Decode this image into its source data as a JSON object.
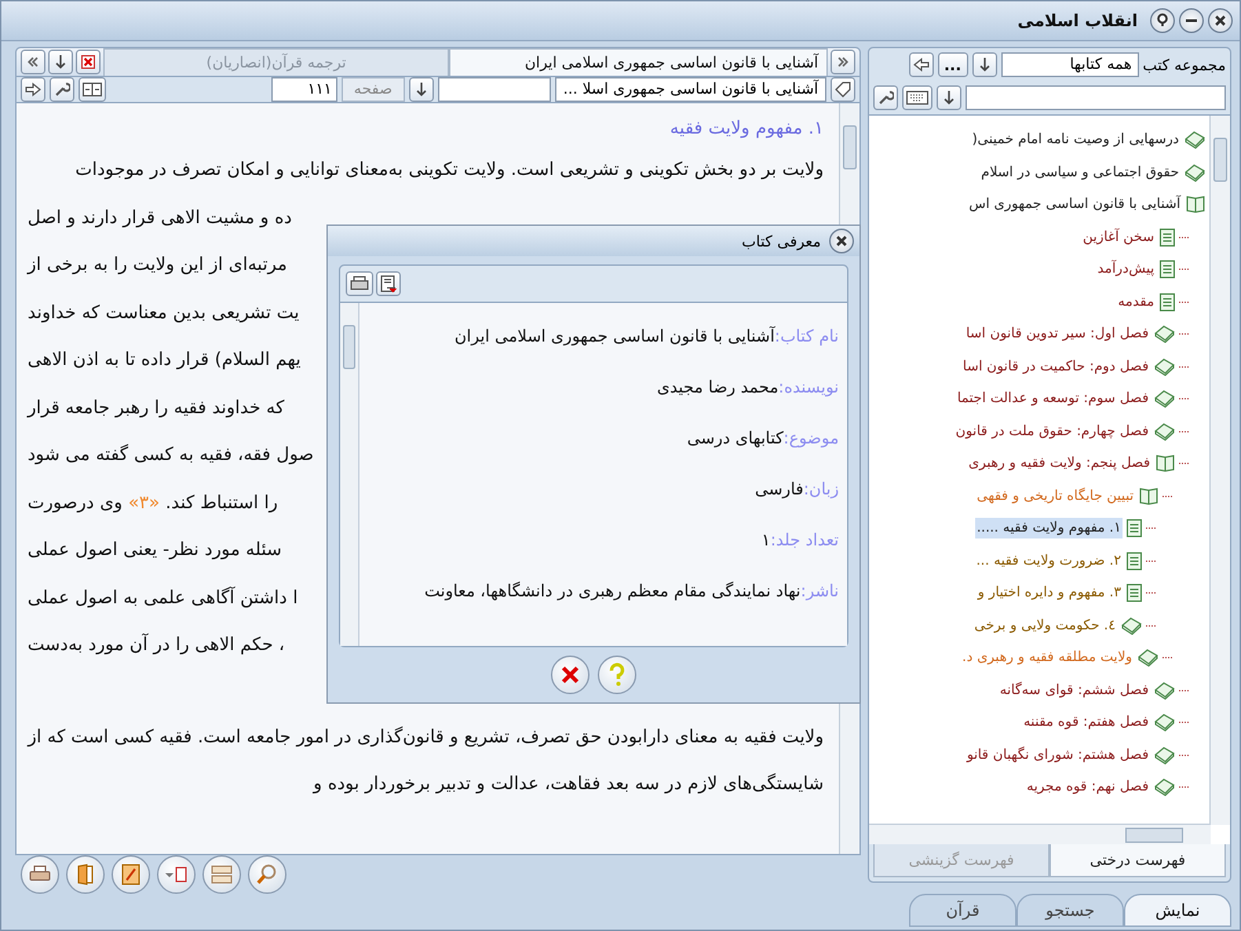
{
  "window": {
    "title": "انقلاب اسلامی"
  },
  "reader": {
    "tabs": [
      {
        "label": "آشنایی با قانون اساسی جمهوری اسلامی ایران",
        "selected": true
      },
      {
        "label": "ترجمه قرآن(انصاریان)",
        "selected": false
      }
    ],
    "book_select": "آشنایی با قانون اساسی جمهوری اسلا ...",
    "page_label": "صفحه",
    "page_value": "۱۱۱",
    "heading": "۱. مفهوم ولایت فقیه",
    "paragraphs": [
      {
        "lines": [
          {
            "kind": "full",
            "segments": [
              {
                "text": "ولایت بر دو بخش تکوینی و تشریعی است. ولایت تکوینی به‌معنای توانایی و امکان تصرف در موجودات"
              }
            ]
          },
          {
            "kind": "partial",
            "segments": [
              {
                "text": "ده و مشیت الاهی قرار دارند و اصل"
              }
            ]
          },
          {
            "kind": "partial",
            "segments": [
              {
                "text": "مرتبه‌ای از این ولایت را به برخی از"
              }
            ]
          },
          {
            "kind": "partial",
            "segments": [
              {
                "text": "یت تشریعی بدین معناست که خداوند"
              }
            ]
          },
          {
            "kind": "partial",
            "segments": [
              {
                "text": "یهم السلام) قرار داده تا به اذن الاهی"
              }
            ]
          },
          {
            "kind": "partial",
            "segments": [
              {
                "text": "که خداوند فقیه را رهبر جامعه قرار"
              }
            ]
          },
          {
            "kind": "partial",
            "segments": [
              {
                "text": "صول فقه، فقیه به کسی گفته می شود"
              }
            ]
          },
          {
            "kind": "partial",
            "segments": [
              {
                "text": "را استنباط کند. "
              },
              {
                "text": "«۳»",
                "kind": "footnote"
              },
              {
                "text": " وی درصورت"
              }
            ]
          },
          {
            "kind": "partial",
            "segments": [
              {
                "text": "سئله مورد نظر- یعنی اصول عملی"
              }
            ]
          },
          {
            "kind": "partial",
            "segments": [
              {
                "text": "ا داشتن آگاهی علمی به اصول عملی"
              }
            ]
          },
          {
            "kind": "partial",
            "segments": [
              {
                "text": "، حکم الاهی را در آن مورد به‌دست"
              }
            ]
          }
        ]
      },
      {
        "lines": [
          {
            "kind": "full",
            "segments": [
              {
                "text": "ولایت فقیه به معنای دارابودن حق تصرف، تشریع و قانون‌گذاری در امور جامعه است. فقیه کسی است که از"
              }
            ]
          },
          {
            "kind": "full",
            "segments": [
              {
                "text": "شایستگی‌های لازم در سه بعد فقاهت، عدالت و تدبیر برخوردار بوده و"
              }
            ]
          }
        ]
      }
    ]
  },
  "dialog": {
    "title": "معرفی کتاب",
    "fields": [
      {
        "label": "نام کتاب:",
        "value": "آشنایی با قانون اساسی جمهوری اسلامی ایران"
      },
      {
        "label": "نویسنده:",
        "value": "محمد رضا مجیدی"
      },
      {
        "label": "موضوع:",
        "value": "کتابهای درسی"
      },
      {
        "label": "زبان:",
        "value": "فارسی"
      },
      {
        "label": "تعداد جلد:",
        "value": "۱"
      },
      {
        "label": "ناشر:",
        "value": "نهاد نمایندگی مقام معظم رهبری در دانشگاهها، معاونت"
      }
    ]
  },
  "sidebar": {
    "collection_label": "مجموعه کتب",
    "collection_value": "همه کتابها",
    "more_button": "...",
    "tree": [
      {
        "label": "درسهایی از وصیت نامه امام خمینی(",
        "kind": "book",
        "expanded": false,
        "selected": false
      },
      {
        "label": "حقوق اجتماعی و سیاسی در اسلام",
        "kind": "book",
        "expanded": false,
        "selected": false
      },
      {
        "label": "آشنایی با قانون اساسی جمهوری اس",
        "kind": "book",
        "expanded": true,
        "selected": false,
        "children": [
          {
            "label": "سخن آغازین",
            "kind": "page",
            "selected": false
          },
          {
            "label": "پیش‌درآمد",
            "kind": "page",
            "selected": false
          },
          {
            "label": "مقدمه",
            "kind": "page",
            "selected": false
          },
          {
            "label": "فصل اول: سیر تدوین قانون اسا",
            "kind": "book",
            "expanded": false,
            "selected": false
          },
          {
            "label": "فصل دوم: حاکمیت در قانون اسا",
            "kind": "book",
            "expanded": false,
            "selected": false
          },
          {
            "label": "فصل سوم: توسعه و عدالت اجتما",
            "kind": "book",
            "expanded": false,
            "selected": false
          },
          {
            "label": "فصل چهارم: حقوق ملت در قانون",
            "kind": "book",
            "expanded": false,
            "selected": false
          },
          {
            "label": "فصل پنجم: ولایت فقیه و رهبری",
            "kind": "book",
            "expanded": true,
            "selected": false,
            "children": [
              {
                "label": "تبیین جایگاه تاریخی و فقهی",
                "kind": "book",
                "expanded": true,
                "selected": false,
                "children": [
                  {
                    "label": "۱. مفهوم ولایت فقیه .....",
                    "kind": "page",
                    "selected": true
                  },
                  {
                    "label": "۲. ضرورت ولایت فقیه ...",
                    "kind": "page",
                    "selected": false
                  },
                  {
                    "label": "۳. مفهوم و دایره اختیار و",
                    "kind": "page",
                    "selected": false
                  },
                  {
                    "label": "٤. حکومت ولایی و برخی",
                    "kind": "book",
                    "expanded": false,
                    "selected": false
                  }
                ]
              },
              {
                "label": "ولایت مطلقه فقیه و رهبری د.",
                "kind": "book",
                "expanded": false,
                "selected": false
              }
            ]
          },
          {
            "label": "فصل ششم: قوای سه‌گانه",
            "kind": "book",
            "expanded": false,
            "selected": false
          },
          {
            "label": "فصل هفتم: قوه مقننه",
            "kind": "book",
            "expanded": false,
            "selected": false
          },
          {
            "label": "فصل هشتم: شورای نگهبان قانو",
            "kind": "book",
            "expanded": false,
            "selected": false
          },
          {
            "label": "فصل نهم: قوه مجریه",
            "kind": "book",
            "expanded": false,
            "selected": false
          }
        ]
      }
    ],
    "tabs": [
      {
        "label": "فهرست درختی",
        "selected": true
      },
      {
        "label": "فهرست گزینشی",
        "selected": false
      }
    ]
  },
  "bottom_tabs": [
    {
      "label": "نمایش",
      "selected": true
    },
    {
      "label": "جستجو",
      "selected": false
    },
    {
      "label": "قرآن",
      "selected": false
    }
  ]
}
